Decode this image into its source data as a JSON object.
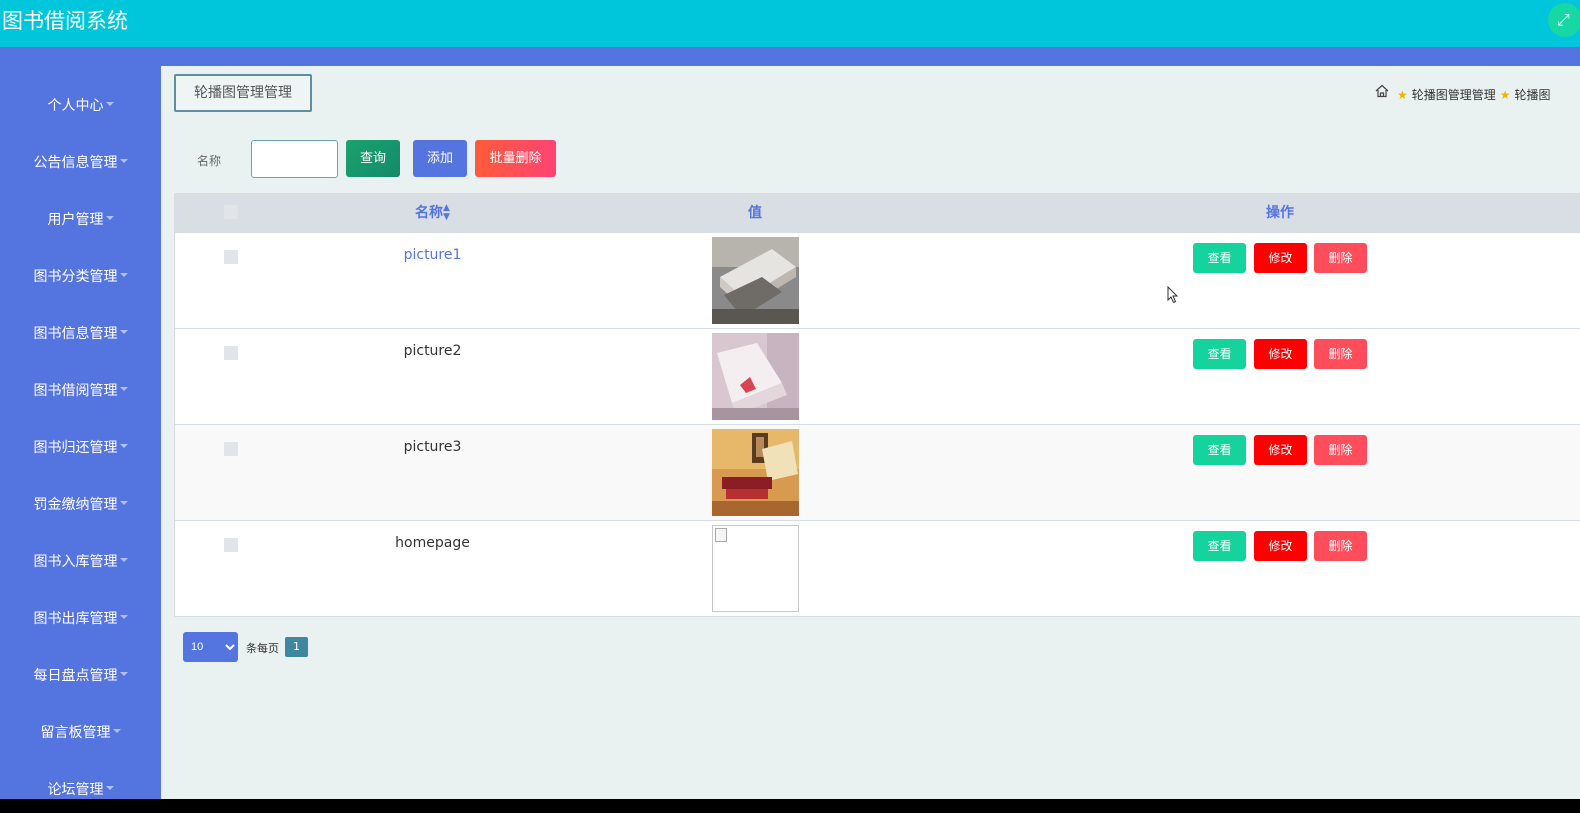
{
  "app": {
    "title": "图书借阅系统",
    "fullscreen_icon": "expand-arrows-icon"
  },
  "sidebar": {
    "items": [
      {
        "label": "个人中心"
      },
      {
        "label": "公告信息管理"
      },
      {
        "label": "用户管理"
      },
      {
        "label": "图书分类管理"
      },
      {
        "label": "图书信息管理"
      },
      {
        "label": "图书借阅管理"
      },
      {
        "label": "图书归还管理"
      },
      {
        "label": "罚金缴纳管理"
      },
      {
        "label": "图书入库管理"
      },
      {
        "label": "图书出库管理"
      },
      {
        "label": "每日盘点管理"
      },
      {
        "label": "留言板管理"
      },
      {
        "label": "论坛管理"
      }
    ]
  },
  "page": {
    "title": "轮播图管理管理"
  },
  "breadcrumb": {
    "items": [
      "轮播图管理管理",
      "轮播图"
    ]
  },
  "search": {
    "label": "名称",
    "value": "",
    "placeholder": ""
  },
  "toolbar": {
    "query_label": "查询",
    "add_label": "添加",
    "batch_delete_label": "批量删除"
  },
  "table": {
    "columns": {
      "name": "名称",
      "value": "值",
      "actions": "操作"
    },
    "rows": [
      {
        "name": "picture1",
        "image": "photo-stacked-books"
      },
      {
        "name": "picture2",
        "image": "photo-open-book"
      },
      {
        "name": "picture3",
        "image": "photo-books-warm"
      },
      {
        "name": "homepage",
        "image": "broken-image"
      }
    ],
    "actions": {
      "view": "查看",
      "edit": "修改",
      "delete": "删除"
    }
  },
  "pagination": {
    "page_size": "10",
    "page_size_options": [
      "10"
    ],
    "per_page_label": "条每页",
    "current_page": "1"
  },
  "colors": {
    "topbar": "#00c6dc",
    "sidebar": "#5474e0",
    "view": "#14d49b",
    "edit": "#ff0000",
    "delete": "#ff4d5b"
  }
}
